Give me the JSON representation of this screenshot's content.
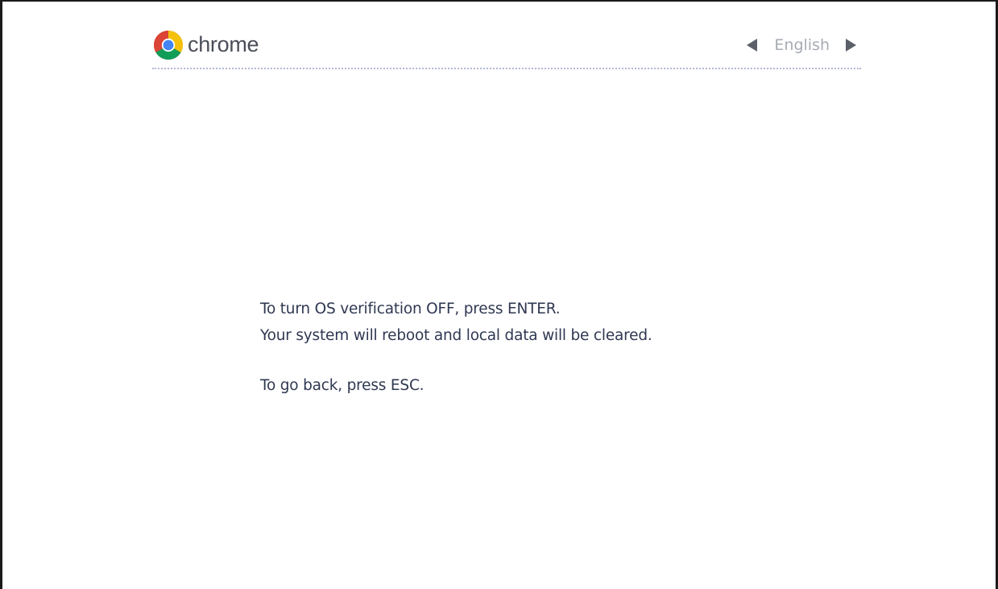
{
  "header": {
    "brand_text": "chrome",
    "logo_icon": "chrome-logo-icon",
    "language": "English",
    "prev_language_icon": "left-triangle-icon",
    "next_language_icon": "right-triangle-icon"
  },
  "message": {
    "line1": "To turn OS verification OFF, press ENTER.",
    "line2": "Your system will reboot and local data will be cleared.",
    "line3": "To go back, press ESC."
  },
  "colors": {
    "text": "#2f3852",
    "brand_text": "#4a4e58",
    "language_text": "#a7abb3",
    "divider": "#b4b8d6",
    "chrome_red": "#db4437",
    "chrome_yellow": "#f4c20d",
    "chrome_green": "#0f9d58",
    "chrome_blue": "#4285f4"
  }
}
